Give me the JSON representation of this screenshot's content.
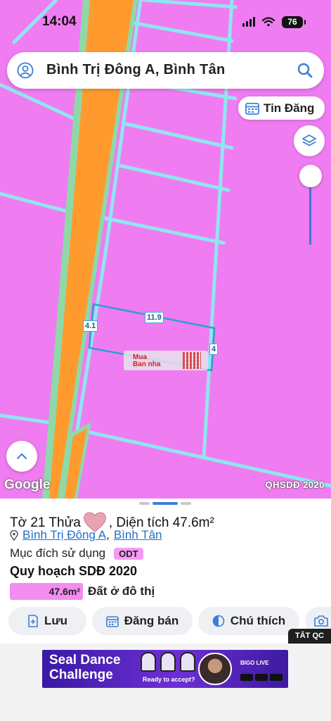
{
  "status_bar": {
    "time": "14:04",
    "battery": "76"
  },
  "search": {
    "query": "Bình Trị Đông A, Bình Tân"
  },
  "map": {
    "tin_dang_label": "Tin Đăng",
    "google_logo": "Google",
    "layer_label": "QHSDĐ 2020",
    "plot_dims": {
      "top": "11.9",
      "left": "4.1",
      "right": "4"
    },
    "watermark_top": "Mua",
    "watermark_bottom": "Ban nha",
    "colors": {
      "land": "#f07cf2",
      "road": "#ff9b2e",
      "road_border": "#8fd9a8",
      "lot_line": "#8fe6f0",
      "selected_outline": "#2a9fd6"
    }
  },
  "sheet": {
    "title_prefix": "Tờ 21 Thửa",
    "title_suffix": ", Diện tích 47.6m²",
    "ward": "Bình Trị Đông A",
    "separator": ",",
    "district": "Bình Tân",
    "purpose_label": "Mục đích sử dụng",
    "purpose_code": "ODT",
    "plan_title": "Quy hoạch SDĐ 2020",
    "legend_area": "47.6m²",
    "legend_text": "Đất ở đô thị",
    "actions": [
      {
        "label": "Lưu",
        "icon": "bookmark-plus-icon"
      },
      {
        "label": "Đăng bán",
        "icon": "calendar-icon"
      },
      {
        "label": "Chú thích",
        "icon": "contrast-icon"
      },
      {
        "label": "",
        "icon": "camera-plus-icon"
      }
    ]
  },
  "ad": {
    "close_tag": "TẮT QC",
    "headline_line1": "Seal Dance",
    "headline_line2": "Challenge",
    "subline": "Ready to accept?",
    "brand": "BIGO LIVE"
  }
}
